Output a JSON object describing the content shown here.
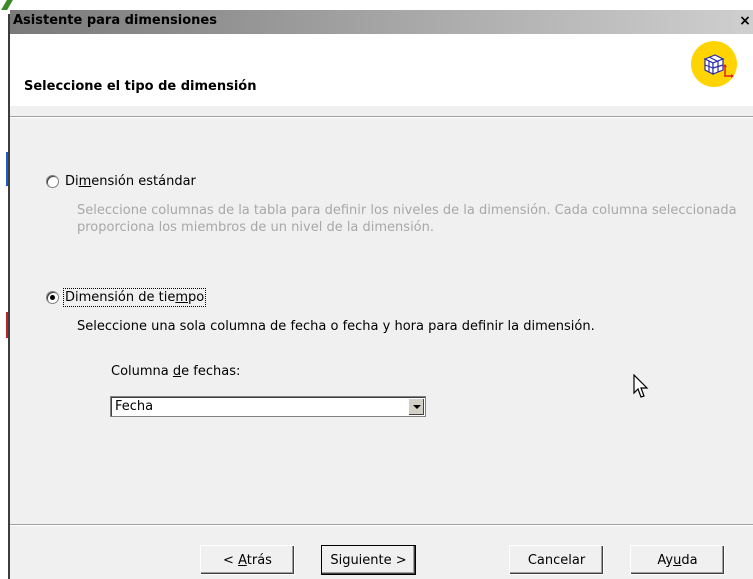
{
  "window": {
    "title": "Asistente para dimensiones",
    "close_glyph": "×"
  },
  "header": {
    "heading": "Seleccione el tipo de dimensión",
    "icon": "cube-icon"
  },
  "options": {
    "standard": {
      "label_pre": "Di",
      "label_mnemonic": "m",
      "label_post": "ensión estándar",
      "description": "Seleccione columnas de la tabla para definir los niveles de la dimensión. Cada columna seleccionada proporciona los miembros de un nivel de la dimensión.",
      "selected": false
    },
    "time": {
      "label_pre": "Dimensión de tie",
      "label_mnemonic": "m",
      "label_post": "po",
      "description": "Seleccione una sola columna de fecha o fecha y hora para definir la dimensión.",
      "selected": true
    }
  },
  "date_column": {
    "label_pre": "Columna ",
    "label_mnemonic": "d",
    "label_post": "e fechas:",
    "value": "Fecha"
  },
  "buttons": {
    "back": {
      "pre": "< ",
      "mnemonic": "A",
      "post": "trás"
    },
    "next": {
      "pre": "Siguiente >",
      "mnemonic": "",
      "post": ""
    },
    "cancel": {
      "pre": "Cancelar",
      "mnemonic": "",
      "post": ""
    },
    "help": {
      "pre": "Ay",
      "mnemonic": "u",
      "post": "da"
    }
  },
  "colors": {
    "accent_logo": "#ffd400",
    "disabled_text": "#a8a8a8"
  }
}
